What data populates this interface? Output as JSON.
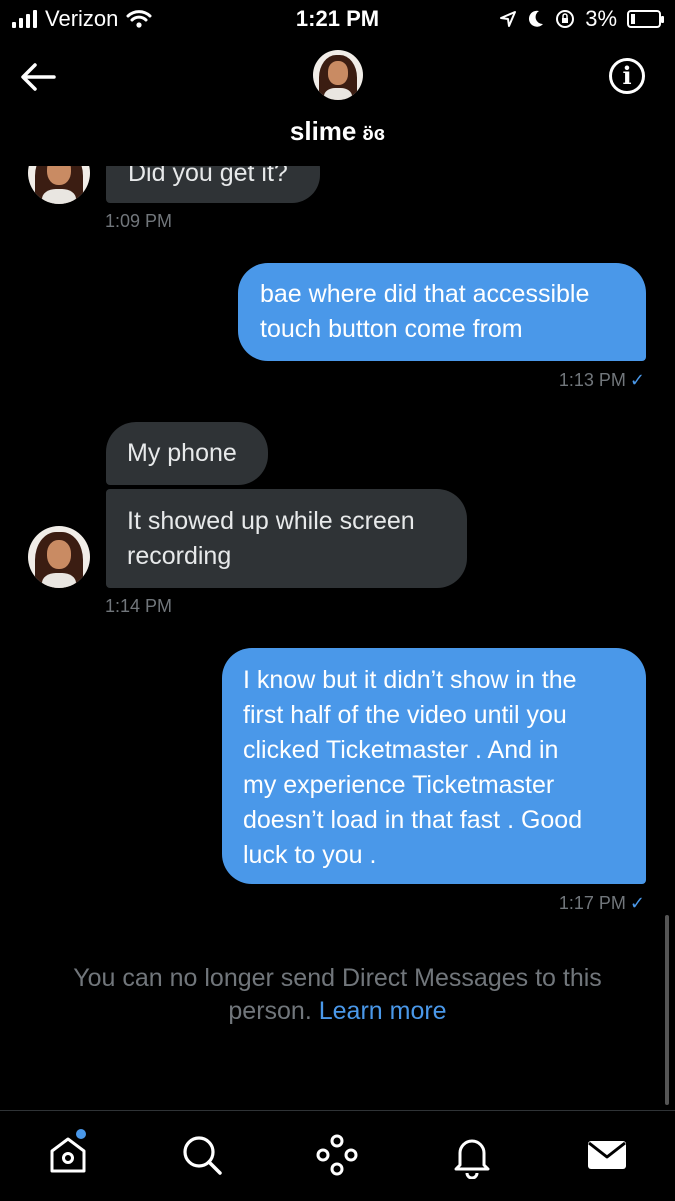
{
  "status_bar": {
    "carrier": "Verizon",
    "time": "1:21 PM",
    "battery": "3%"
  },
  "header": {
    "name": "slime",
    "name_emoji": "ʚ̈ɞ",
    "info_symbol": "i"
  },
  "messages": [
    {
      "direction": "incoming",
      "text": "Did you get it?",
      "time": "1:09 PM"
    },
    {
      "direction": "outgoing",
      "text": "bae where did that accessible\ntouch button come from",
      "time": "1:13 PM"
    },
    {
      "direction": "incoming",
      "text": "My phone"
    },
    {
      "direction": "incoming",
      "text": "It showed up while screen\nrecording",
      "time": "1:14 PM"
    },
    {
      "direction": "outgoing",
      "text": "I know but it didn’t show in the\nfirst half of the video  until you\nclicked Ticketmaster . And in\nmy experience Ticketmaster\ndoesn’t load in that fast . Good\nluck to you .",
      "time": "1:17 PM"
    }
  ],
  "read_check": "✓",
  "notice": {
    "text": "You can no longer send Direct Messages to this person.",
    "link": "Learn more"
  },
  "tabbar": {
    "items": [
      "home-icon",
      "search-icon",
      "spaces-icon",
      "notifications-icon",
      "messages-icon"
    ]
  },
  "colors": {
    "accent": "#4a98e9",
    "incoming_bubble": "#2f3336",
    "background": "#000000"
  }
}
